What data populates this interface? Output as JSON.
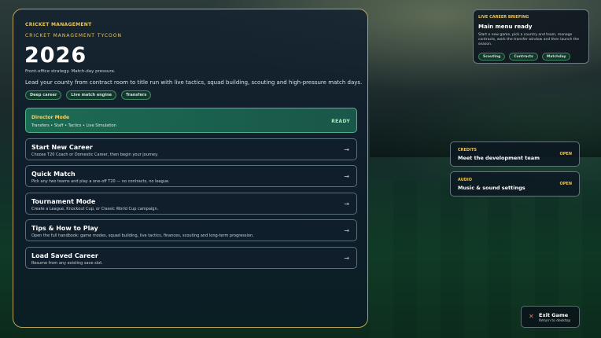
{
  "brand": "CRICKET MANAGEMENT",
  "subtitle": "CRICKET MANAGEMENT TYCOON",
  "year": "2026",
  "tagline": "Front-office strategy. Match-day pressure.",
  "description": "Lead your county from contract room to title run with live tactics, squad building, scouting and high-pressure match days.",
  "chips": [
    "Deep career",
    "Live match engine",
    "Transfers"
  ],
  "featured": {
    "title": "Director Mode",
    "subtitle": "Transfers • Staff • Tactics • Live Simulation",
    "status": "READY"
  },
  "menu": [
    {
      "title": "Start New Career",
      "subtitle": "Choose T20 Coach or Domestic Career, then begin your journey.",
      "arrow": "→"
    },
    {
      "title": "Quick Match",
      "subtitle": "Pick any two teams and play a one-off T20 — no contracts, no league.",
      "arrow": "→"
    },
    {
      "title": "Tournament Mode",
      "subtitle": "Create a League, Knockout Cup, or Classic World Cup campaign.",
      "arrow": "→"
    },
    {
      "title": "Tips & How to Play",
      "subtitle": "Open the full handbook: game modes, squad building, live tactics, finances, scouting and long-term progression.",
      "arrow": "→"
    },
    {
      "title": "Load Saved Career",
      "subtitle": "Resume from any existing save slot.",
      "arrow": "→"
    }
  ],
  "briefing": {
    "label": "LIVE CAREER BRIEFING",
    "title": "Main menu ready",
    "text": "Start a new game, pick a country and team, manage contracts, work the transfer window and then launch the season.",
    "chips": [
      "Scouting",
      "Contracts",
      "Matchday"
    ]
  },
  "credits": {
    "label": "CREDITS",
    "title": "Meet the development team",
    "action": "OPEN"
  },
  "audio": {
    "label": "AUDIO",
    "title": "Music & sound settings",
    "action": "OPEN"
  },
  "exit": {
    "icon": "✕",
    "title": "Exit Game",
    "subtitle": "Return to desktop"
  },
  "colors": {
    "accent_gold": "#e8c45a",
    "ready_green": "#9ef0bd",
    "featured_bg": "#1e785a"
  }
}
